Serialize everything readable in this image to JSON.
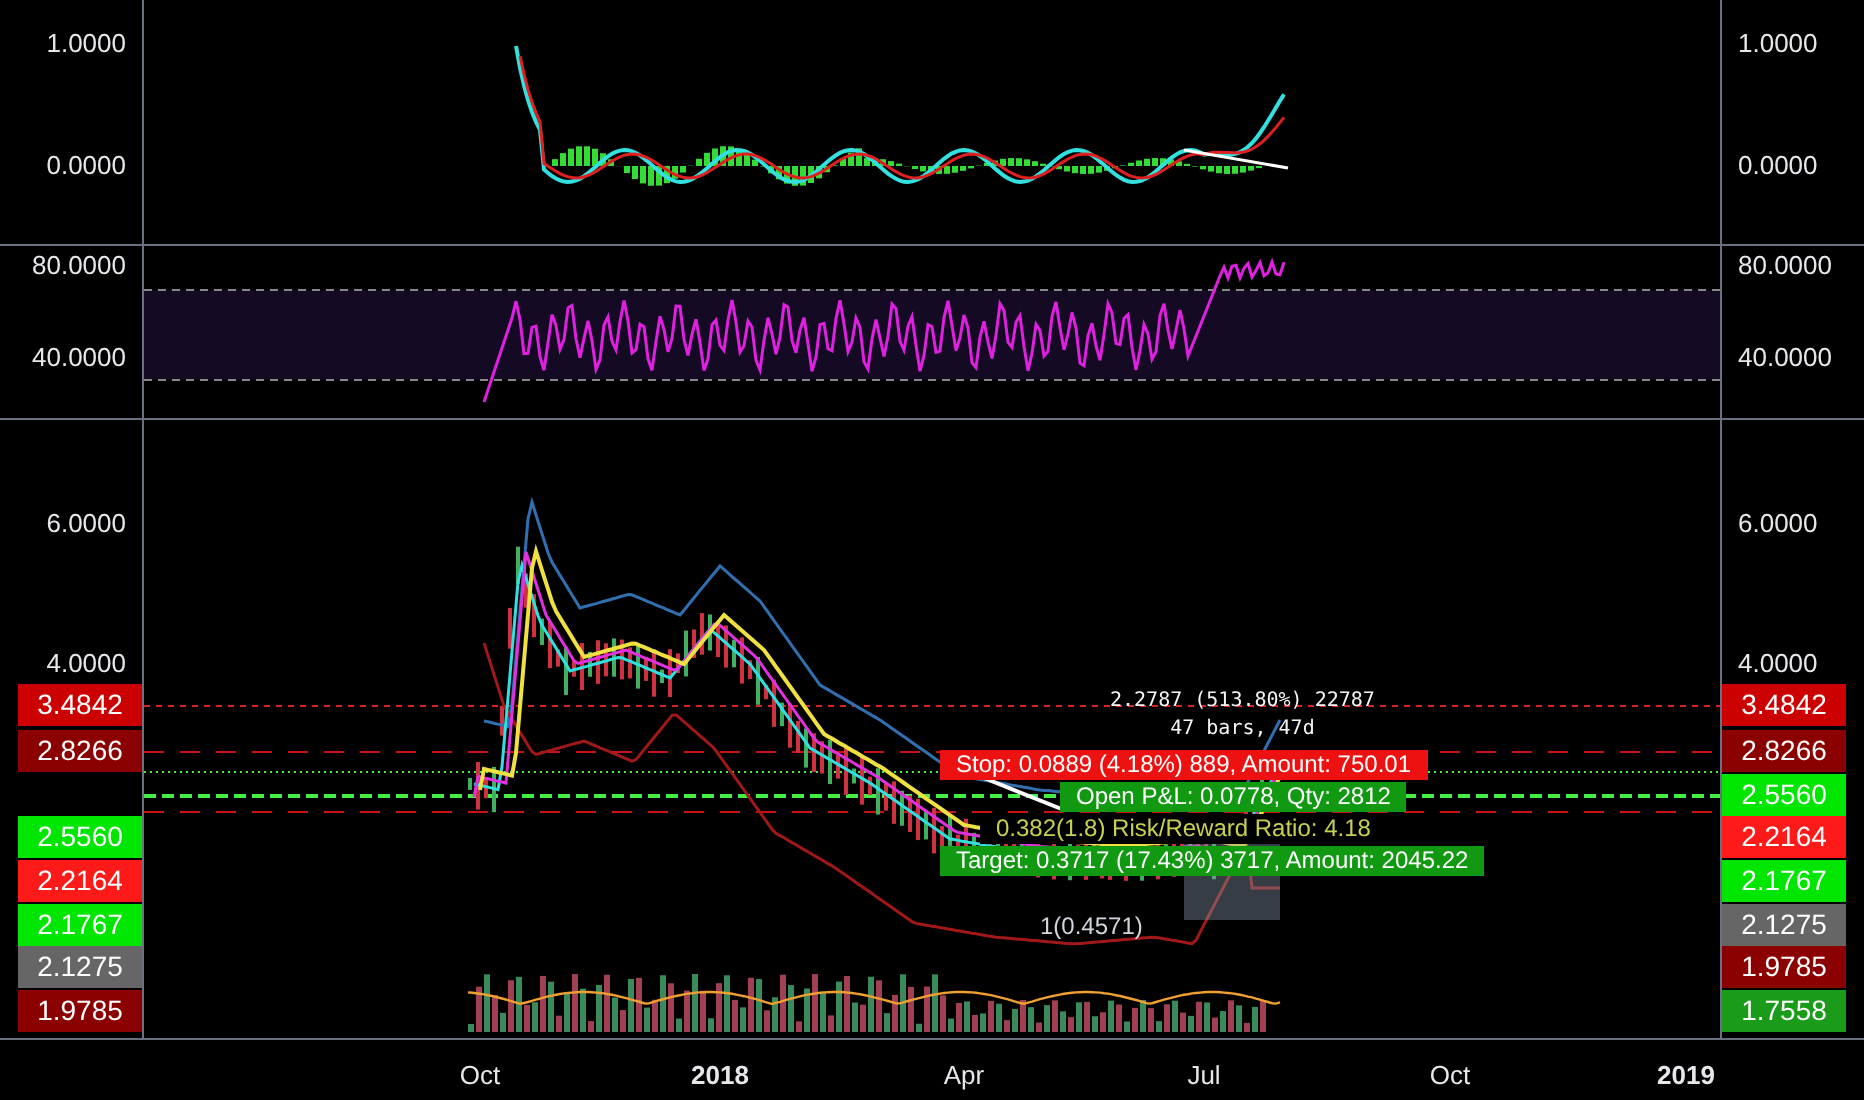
{
  "macd_panel": {
    "left_axis": [
      "1.0000",
      "0.0000"
    ],
    "right_axis": [
      "1.0000",
      "0.0000"
    ]
  },
  "rsi_panel": {
    "left_axis": [
      "80.0000",
      "40.0000"
    ],
    "right_axis": [
      "80.0000",
      "40.0000"
    ]
  },
  "price_panel": {
    "left_axis": [
      "6.0000",
      "4.0000"
    ],
    "right_axis": [
      "6.0000",
      "4.0000"
    ],
    "left_price_tags": [
      {
        "value": "3.4842",
        "color": "#cc0000"
      },
      {
        "value": "2.8266",
        "color": "#8b0000"
      },
      {
        "value": "2.5560",
        "color": "#00e600"
      },
      {
        "value": "2.2164",
        "color": "#ff1a1a"
      },
      {
        "value": "2.1767",
        "color": "#00e600"
      },
      {
        "value": "2.1275",
        "color": "#666666"
      },
      {
        "value": "1.9785",
        "color": "#8b0000"
      }
    ],
    "right_price_tags": [
      {
        "value": "3.4842",
        "color": "#cc0000"
      },
      {
        "value": "2.8266",
        "color": "#8b0000"
      },
      {
        "value": "2.5560",
        "color": "#00e600"
      },
      {
        "value": "2.2164",
        "color": "#ff1a1a"
      },
      {
        "value": "2.1767",
        "color": "#00e600"
      },
      {
        "value": "2.1275",
        "color": "#666666"
      },
      {
        "value": "1.9785",
        "color": "#8b0000"
      },
      {
        "value": "1.7558",
        "color": "#1a9c1a"
      }
    ],
    "measure": [
      "2.2787 (513.80%) 22787",
      "47 bars, 47d"
    ],
    "position": {
      "stop": "Stop: 0.0889 (4.18%) 889, Amount: 750.01",
      "open_pnl": "Open P&L: 0.0778, Qty: 2812",
      "ratio": "0.382(1.8) Risk/Reward Ratio: 4.18",
      "target": "Target: 0.3717 (17.43%) 3717, Amount: 2045.22"
    },
    "fib_label": "1(0.4571)"
  },
  "time_axis": [
    {
      "label": "Oct",
      "bold": false
    },
    {
      "label": "2018",
      "bold": true
    },
    {
      "label": "Apr",
      "bold": false
    },
    {
      "label": "Jul",
      "bold": false
    },
    {
      "label": "Oct",
      "bold": false
    },
    {
      "label": "2019",
      "bold": true
    }
  ]
}
